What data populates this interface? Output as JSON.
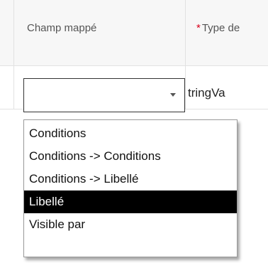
{
  "table": {
    "columns": [
      {
        "label": "Champ mappé",
        "required": false
      },
      {
        "label": "Type de",
        "required": true,
        "required_marker": "*"
      }
    ],
    "row": {
      "mapped_field_value": "",
      "type_value": "tringVa"
    }
  },
  "dropdown": {
    "options": [
      "Conditions",
      "Conditions -> Conditions",
      "Conditions -> Libellé",
      "Libellé",
      "Visible par"
    ],
    "highlighted": "Libellé"
  },
  "colors": {
    "required_star": "#d9001b",
    "highlight_bg": "#000000",
    "highlight_text": "#ffffff"
  }
}
